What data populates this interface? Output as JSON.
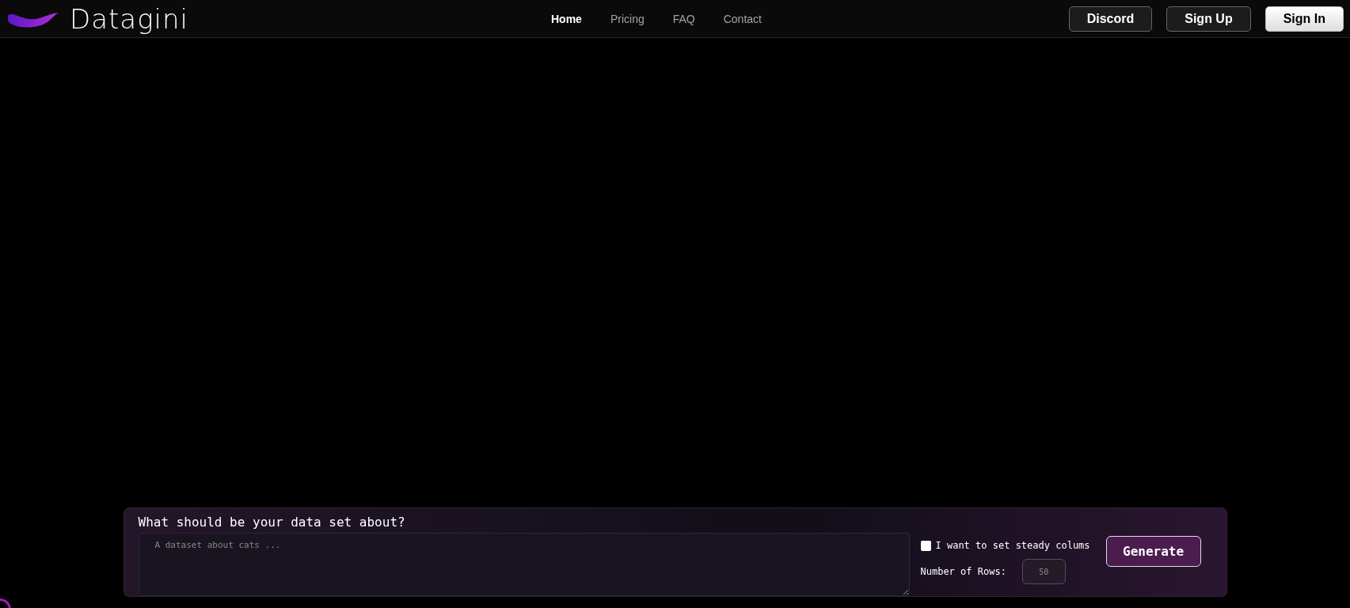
{
  "header": {
    "logo_text": "Datagini",
    "nav": [
      {
        "label": "Home",
        "selected": true
      },
      {
        "label": "Pricing",
        "selected": false
      },
      {
        "label": "FAQ",
        "selected": false
      },
      {
        "label": "Contact",
        "selected": false
      }
    ],
    "buttons": [
      {
        "label": "Discord",
        "kind": "outline"
      },
      {
        "label": "Sign Up",
        "kind": "outline"
      },
      {
        "label": "Sign In",
        "kind": "solid"
      }
    ]
  },
  "prompt_panel": {
    "title": "What should be your data set about?",
    "placeholder": "A dataset about cats ...",
    "steady_columns": {
      "label": "I want to set steady colums",
      "checked": false
    },
    "rows": {
      "label": "Number of Rows:",
      "placeholder": "50"
    },
    "generate_button": "Generate"
  }
}
